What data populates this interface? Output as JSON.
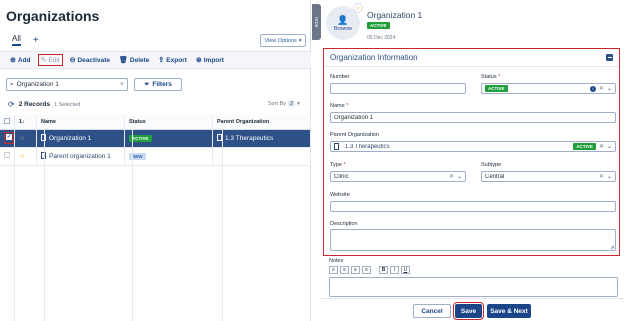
{
  "left": {
    "title": "Organizations",
    "tabs": {
      "all": "All",
      "add": "+"
    },
    "view_options": "View Options",
    "toolbar": {
      "add": "Add",
      "edit": "Edit",
      "deactivate": "Deactivate",
      "delete": "Delete",
      "export": "Export",
      "import": "Import"
    },
    "search": {
      "value": "Organization 1",
      "clear": "×"
    },
    "filters_label": "Filters",
    "records": {
      "count": "2 Records",
      "selected": "1 Selected"
    },
    "sort": {
      "label": "Sort By",
      "count": "2"
    },
    "columns": {
      "num": "1↓",
      "name": "Name",
      "status": "Status",
      "parent": "Parent Organization"
    },
    "rows": [
      {
        "name": "Organization 1",
        "status": "ACTIVE",
        "parent": "1.3 Therapeutics"
      },
      {
        "name": "Parent organization 1",
        "status": "NEW",
        "parent": ""
      }
    ]
  },
  "hide_tab": "HIDE",
  "right": {
    "browse_label": "Browse",
    "title": "Organization 1",
    "status": "ACTIVE",
    "date": "05 Dec 2024",
    "section_title": "Organization Information",
    "fields": {
      "number": {
        "label": "Number",
        "value": ""
      },
      "status": {
        "label": "Status",
        "value": "ACTIVE"
      },
      "name": {
        "label": "Name",
        "value": "Organization 1"
      },
      "parent": {
        "label": "Parent Organization",
        "value": "1.3 Therapeutics",
        "badge": "ACTIVE"
      },
      "type": {
        "label": "Type",
        "value": "Clinic"
      },
      "subtype": {
        "label": "Subtype",
        "value": "Central"
      },
      "website": {
        "label": "Website",
        "value": ""
      },
      "description": {
        "label": "Description",
        "value": ""
      }
    },
    "notes": {
      "label": "Notes",
      "toolbar": [
        "≡",
        "≡",
        "≡",
        "≡",
        "B",
        "I",
        "U"
      ]
    },
    "footer": {
      "cancel": "Cancel",
      "save": "Save",
      "save_next": "Save & Next"
    }
  },
  "colors": {
    "primary": "#1c4587",
    "selected_row": "#2d5186",
    "active_green": "#1e9f3b",
    "highlight_red": "#c6282d",
    "star": "#f2a31b"
  }
}
